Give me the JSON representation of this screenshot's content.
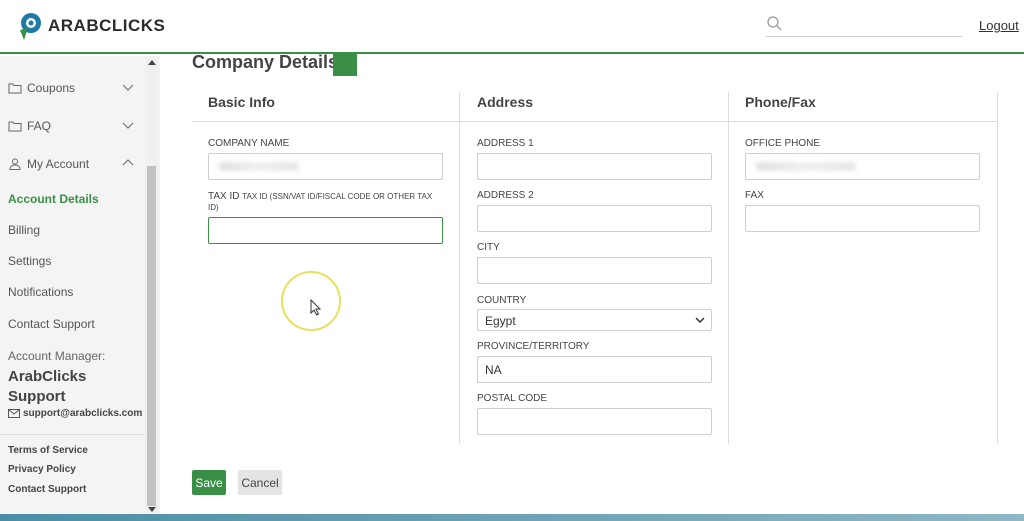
{
  "header": {
    "logo_text": "ARABCLICKS",
    "search_placeholder": "",
    "logout_label": "Logout"
  },
  "sidebar": {
    "items": [
      {
        "label": "Coupons",
        "icon": "folder-icon",
        "expanded": false
      },
      {
        "label": "FAQ",
        "icon": "folder-icon",
        "expanded": false
      },
      {
        "label": "My Account",
        "icon": "user-icon",
        "expanded": true
      }
    ],
    "subitems": [
      {
        "label": "Account Details",
        "active": true
      },
      {
        "label": "Billing",
        "active": false
      },
      {
        "label": "Settings",
        "active": false
      },
      {
        "label": "Notifications",
        "active": false
      },
      {
        "label": "Contact Support",
        "active": false
      }
    ],
    "manager_label": "Account Manager:",
    "manager_name": "ArabClicks Support",
    "manager_email": "support@arabclicks.com",
    "footer_links": [
      "Terms of Service",
      "Privacy Policy",
      "Contact Support"
    ]
  },
  "main": {
    "title": "Company Details",
    "columns": {
      "basic": "Basic Info",
      "address": "Address",
      "phone": "Phone/Fax"
    },
    "basic": {
      "company_name_label": "COMPANY NAME",
      "tax_id_label": "TAX ID",
      "tax_id_hint": "TAX ID (SSN/VAT ID/FISCAL CODE OR OTHER TAX ID)",
      "tax_id_value": ""
    },
    "address": {
      "address1_label": "ADDRESS 1",
      "address1_value": "",
      "address2_label": "ADDRESS 2",
      "address2_value": "",
      "city_label": "CITY",
      "city_value": "",
      "country_label": "COUNTRY",
      "country_value": "Egypt",
      "province_label": "PROVINCE/TERRITORY",
      "province_value": "NA",
      "postal_label": "POSTAL CODE",
      "postal_value": ""
    },
    "phone": {
      "office_label": "OFFICE PHONE",
      "fax_label": "FAX",
      "fax_value": ""
    },
    "save_label": "Save",
    "cancel_label": "Cancel"
  },
  "colors": {
    "accent": "#3a8f46",
    "focus_ring": "#e6e15c"
  }
}
